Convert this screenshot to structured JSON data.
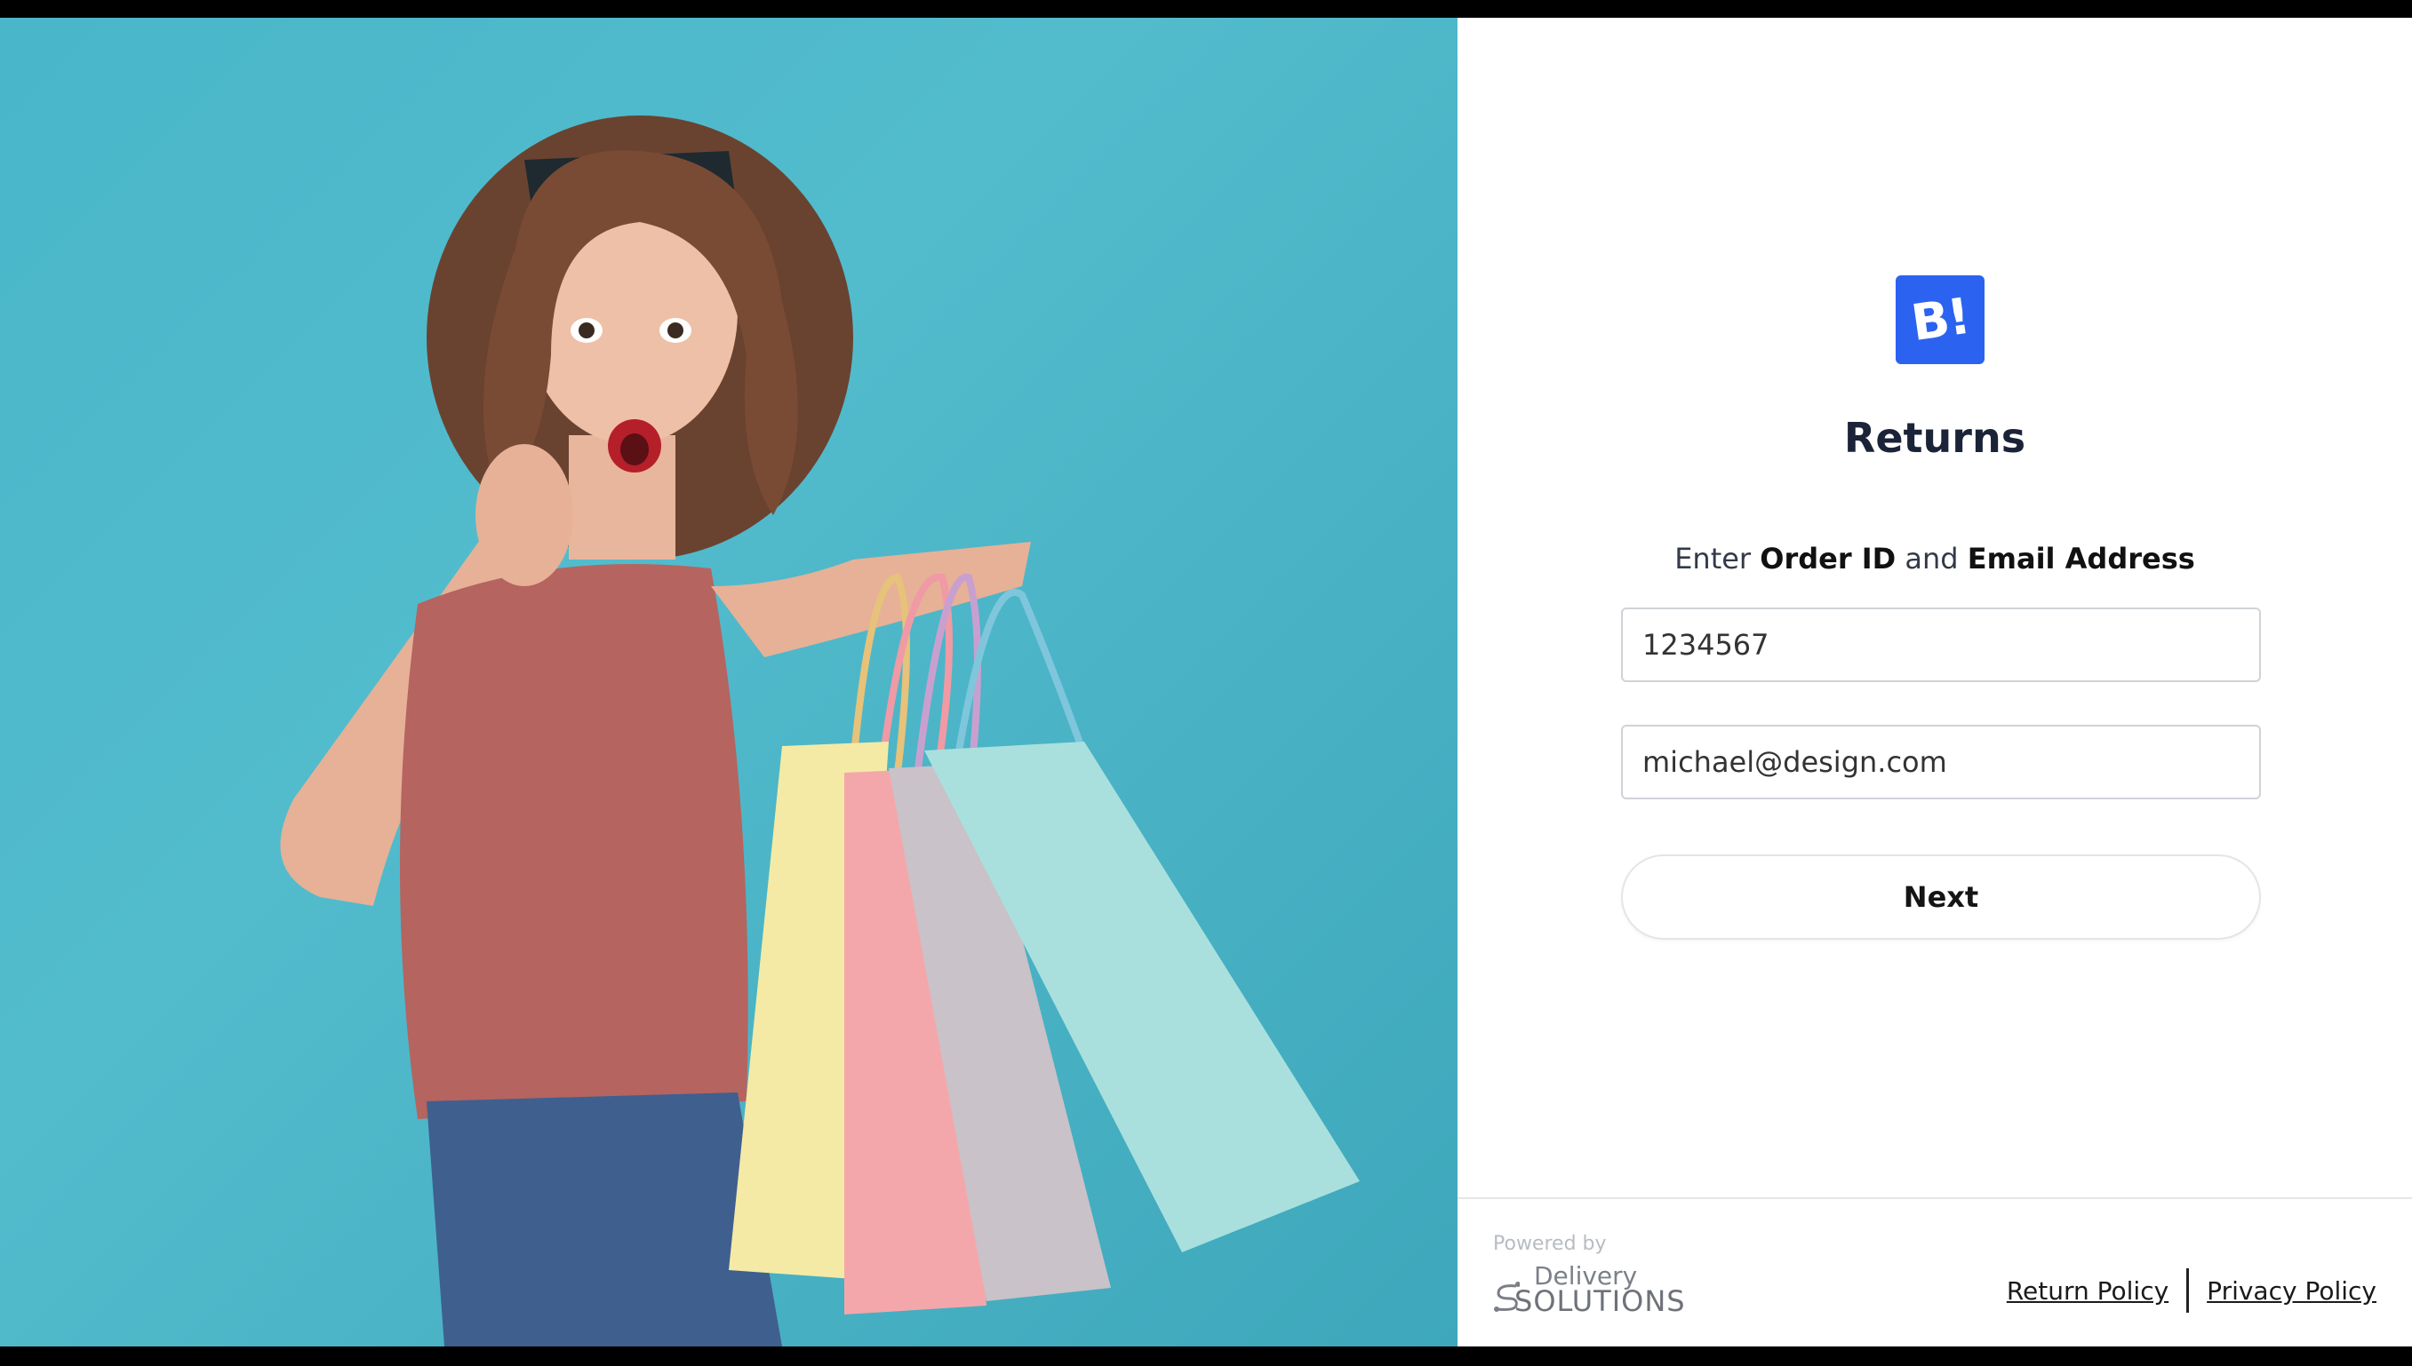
{
  "brand": {
    "logo_text": "B!",
    "accent": "#2b63f0"
  },
  "page": {
    "title": "Returns",
    "instruction_prefix": "Enter",
    "instruction_field1": "Order ID",
    "instruction_mid": "and",
    "instruction_field2": "Email Address"
  },
  "form": {
    "order_id_value": "1234567",
    "email_value": "michael@design.com",
    "next_label": "Next"
  },
  "footer": {
    "powered_by": "Powered by",
    "provider_line1": "Delivery",
    "provider_line2": "SOLUTIONS",
    "links": [
      "Return Policy",
      "Privacy Policy"
    ]
  }
}
